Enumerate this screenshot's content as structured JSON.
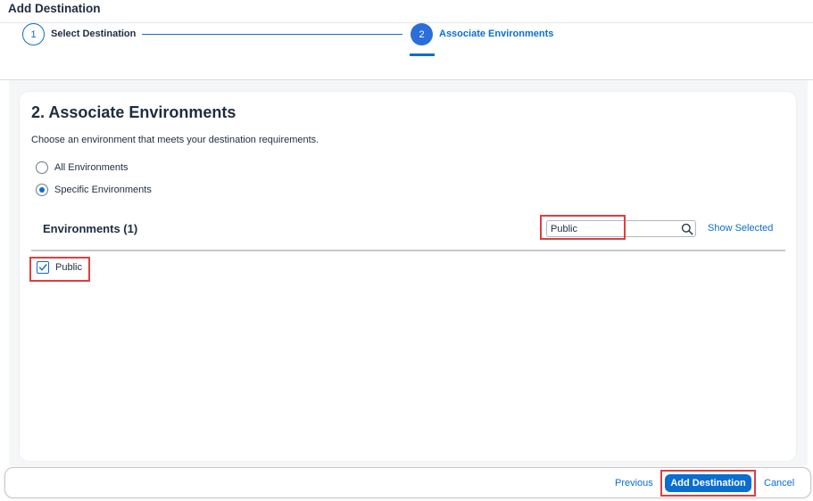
{
  "header": {
    "title": "Add Destination"
  },
  "wizard": {
    "steps": [
      {
        "number": "1",
        "label": "Select Destination",
        "state": "completed"
      },
      {
        "number": "2",
        "label": "Associate Environments",
        "state": "active"
      }
    ]
  },
  "section": {
    "title": "2. Associate Environments",
    "description": "Choose an environment that meets your destination requirements.",
    "options": [
      {
        "label": "All Environments",
        "selected": false
      },
      {
        "label": "Specific Environments",
        "selected": true
      }
    ]
  },
  "environments": {
    "title": "Environments (1)",
    "search_value": "Public",
    "show_selected_label": "Show Selected",
    "items": [
      {
        "label": "Public",
        "checked": true
      }
    ]
  },
  "footer": {
    "previous_label": "Previous",
    "add_label": "Add Destination",
    "cancel_label": "Cancel"
  },
  "colors": {
    "accent": "#0a6ed1",
    "highlight": "#e03e3e"
  }
}
